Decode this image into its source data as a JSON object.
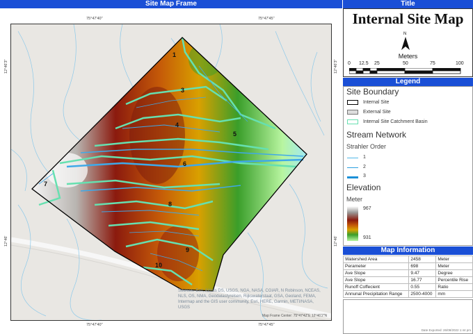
{
  "map_frame": {
    "header": "Site Map Frame",
    "coords": {
      "top_left": "75°47'40\"",
      "top_right": "75°47'45\"",
      "bottom_left": "75°47'40\"",
      "bottom_right": "75°47'45\"",
      "left_top": "12°46'3\"",
      "left_bottom": "12°46'",
      "right_top": "12°46'3\"",
      "right_bottom": "12°46'"
    },
    "catchment_labels": [
      "1",
      "3",
      "4",
      "5",
      "6",
      "7",
      "8",
      "9",
      "10"
    ],
    "attribution": "Sources: Esri, Airbus DS, USGS, NGA, NASA, CGIAR, N Robinson, NCEAS, NLS, OS, NMA, Geodatastyrelsen, Rijkswaterstaat, GSA, Geoland, FEMA, Intermap and the GIS user community, Esri, HERE, Garmin, METI/NASA, USGS",
    "center_text": "Map Frame Center: 75°47'42\"E 12°46'2\"N"
  },
  "title_panel": {
    "header": "Title",
    "title": "Internal Site Map",
    "north": "N",
    "scale_unit": "Meters",
    "scale_ticks": [
      "0",
      "12.5",
      "25",
      "50",
      "75",
      "100"
    ]
  },
  "legend": {
    "header": "Legend",
    "site_boundary": "Site Boundary",
    "internal_site": "Internal Site",
    "external_site": "External Site",
    "catchment": "Internal Site Catchment Basin",
    "stream_network": "Stream Network",
    "strahler": "Strahler Order",
    "orders": [
      "1",
      "2",
      "3"
    ],
    "elevation": "Elevation",
    "unit": "Meter",
    "elev_max": "967",
    "elev_min": "931"
  },
  "info": {
    "header": "Map Information",
    "rows": [
      [
        "Watershed Area",
        "2458",
        "Meter"
      ],
      [
        "Perameter",
        "698",
        "Meter"
      ],
      [
        "Ave Slope",
        "9.47",
        "Degree"
      ],
      [
        "Ave Slope",
        "16.77",
        "Percentile Rise"
      ],
      [
        "Runoff Coffecient",
        "0.55",
        "Ratio"
      ],
      [
        "Annunal Precipitation Range",
        "2500-4000",
        "mm"
      ]
    ]
  },
  "date_exported": "Date Exported: 26/08/2022 1:44 pm",
  "colors": {
    "header": "#1a4fd6",
    "stream": "#4fb8e8",
    "catchment": "#66e0b0",
    "elev_high": "#ffffff",
    "elev_mid_high": "#8b1a0e",
    "elev_mid": "#d9a000",
    "elev_mid_low": "#3a9e2a",
    "elev_low": "#b8f5a0"
  }
}
